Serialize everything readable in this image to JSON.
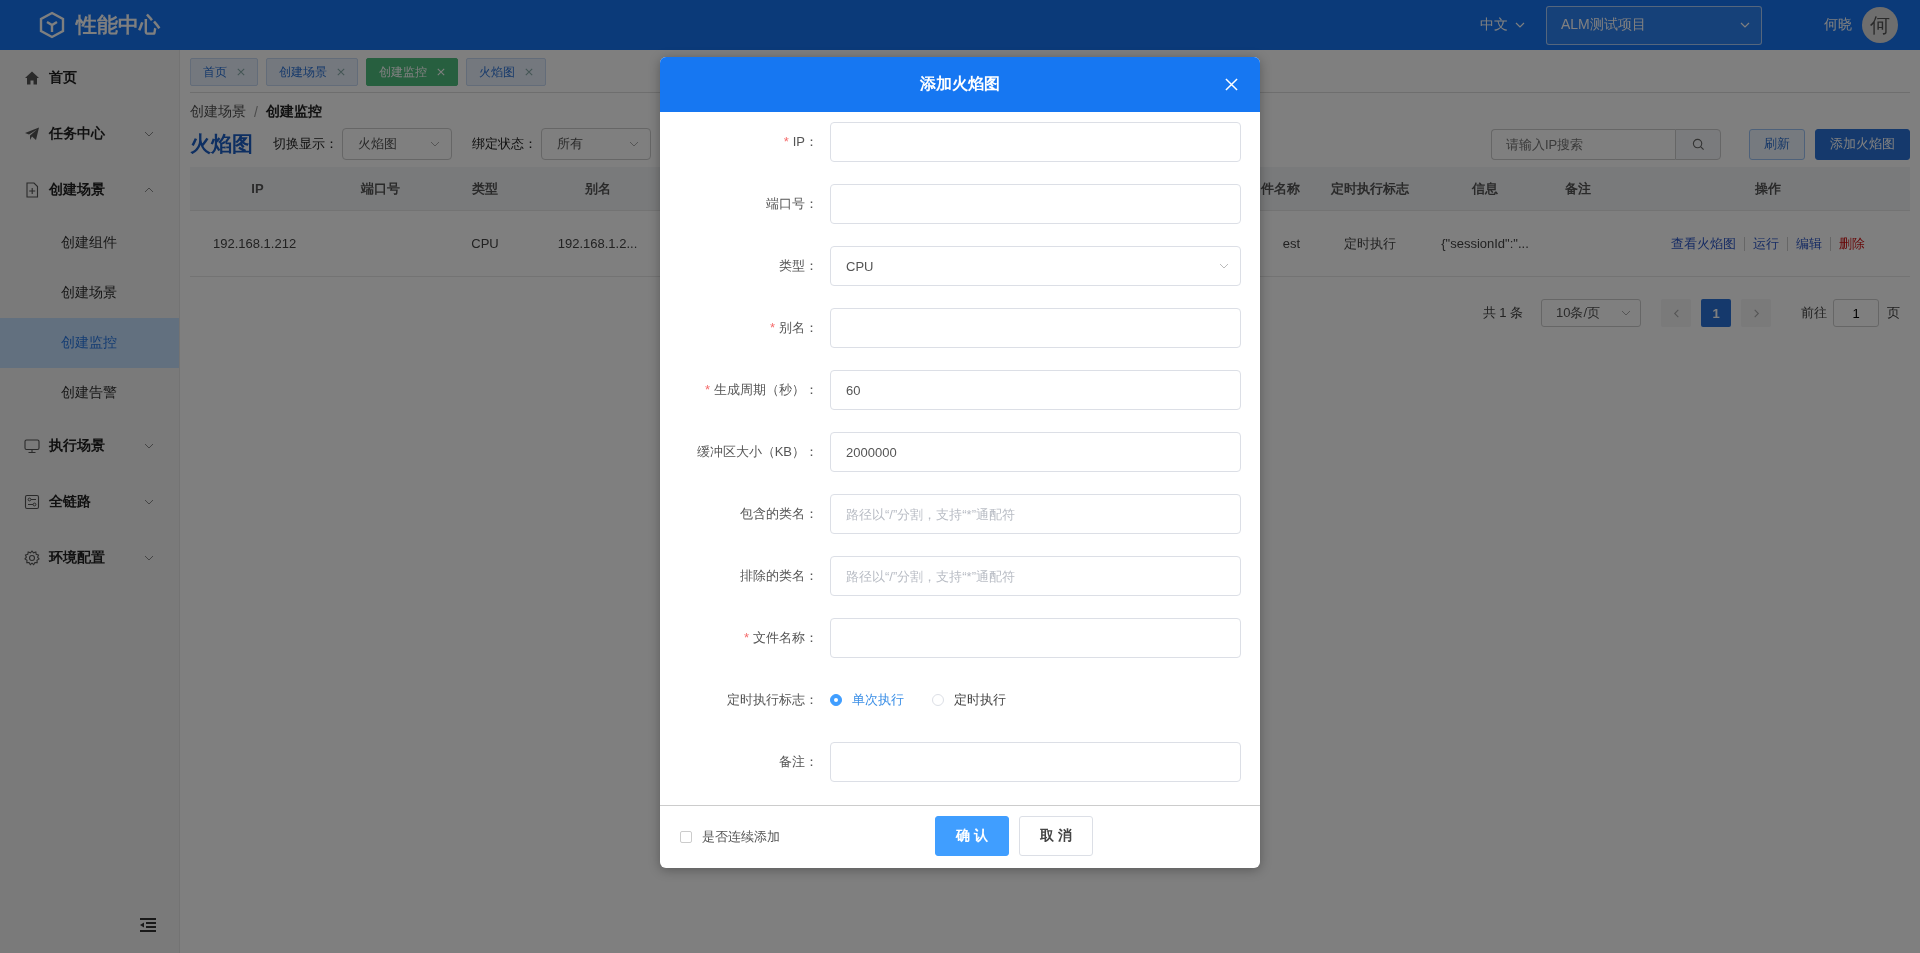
{
  "header": {
    "logo_text": "性能中心",
    "language": "中文",
    "project": "ALM测试项目",
    "user_name": "何晓",
    "avatar_text": "何"
  },
  "sidebar": {
    "items": [
      {
        "label": "首页",
        "selected": false
      },
      {
        "label": "任务中心",
        "selected": false,
        "expanded": false
      },
      {
        "label": "创建场景",
        "selected": false,
        "expanded": true,
        "children": [
          {
            "label": "创建组件",
            "selected": false
          },
          {
            "label": "创建场景",
            "selected": false
          },
          {
            "label": "创建监控",
            "selected": true
          },
          {
            "label": "创建告警",
            "selected": false
          }
        ]
      },
      {
        "label": "执行场景",
        "selected": false,
        "expanded": false
      },
      {
        "label": "全链路",
        "selected": false,
        "expanded": false
      },
      {
        "label": "环境配置",
        "selected": false,
        "expanded": false
      }
    ]
  },
  "tabs": [
    {
      "label": "首页",
      "selected": false
    },
    {
      "label": "创建场景",
      "selected": false
    },
    {
      "label": "创建监控",
      "selected": true
    },
    {
      "label": "火焰图",
      "selected": false
    }
  ],
  "breadcrumb_separator": "/",
  "breadcrumb": [
    {
      "label": "创建场景",
      "current": false
    },
    {
      "label": "创建监控",
      "current": true
    }
  ],
  "page_title": "火焰图",
  "filters": [
    {
      "label": "切换显示：",
      "value": "火焰图"
    },
    {
      "label": "绑定状态：",
      "value": "所有"
    }
  ],
  "search": {
    "placeholder": "请输入IP搜索"
  },
  "toolbar_buttons": [
    {
      "label": "刷新",
      "kind": "plain"
    },
    {
      "label": "添加火焰图",
      "kind": "primary"
    }
  ],
  "table": {
    "columns": [
      "IP",
      "端口号",
      "类型",
      "别名",
      "件名称",
      "定时执行标志",
      "信息",
      "备注",
      "操作"
    ],
    "rows": [
      {
        "cells": [
          "192.168.1.212",
          "",
          "CPU",
          "192.168.1.2...",
          "est",
          "定时执行",
          "{\"sessionId\":\"...",
          ""
        ],
        "actions": [
          {
            "label": "查看火焰图",
            "kind": "link"
          },
          {
            "label": "运行",
            "kind": "link"
          },
          {
            "label": "编辑",
            "kind": "link"
          },
          {
            "label": "删除",
            "kind": "danger"
          }
        ]
      }
    ]
  },
  "pagination": {
    "total": "共 1 条",
    "page_size": "10条/页",
    "pages": [
      {
        "label": "1",
        "selected": true
      }
    ],
    "goto_label": "前往",
    "goto_value": "1",
    "goto_suffix": "页"
  },
  "dialog": {
    "title": "添加火焰图",
    "required_mark": "*",
    "fields": [
      {
        "label": "IP：",
        "required": true,
        "kind": "input"
      },
      {
        "label": "端口号：",
        "required": false,
        "kind": "input"
      },
      {
        "label": "类型：",
        "required": false,
        "kind": "select",
        "value": "CPU"
      },
      {
        "label": "别名：",
        "required": true,
        "kind": "input"
      },
      {
        "label": "生成周期（秒）：",
        "required": true,
        "kind": "input",
        "value": "60"
      },
      {
        "label": "缓冲区大小（KB）：",
        "required": false,
        "kind": "input",
        "value": "2000000"
      },
      {
        "label": "包含的类名：",
        "required": false,
        "kind": "input",
        "placeholder": "路径以“/”分割，支持“*”通配符"
      },
      {
        "label": "排除的类名：",
        "required": false,
        "kind": "input",
        "placeholder": "路径以“/”分割，支持“*”通配符"
      },
      {
        "label": "文件名称：",
        "required": true,
        "kind": "input"
      },
      {
        "label": "定时执行标志：",
        "required": false,
        "kind": "radio",
        "options": [
          {
            "label": "单次执行",
            "selected": true
          },
          {
            "label": "定时执行",
            "selected": false
          }
        ]
      },
      {
        "label": "备注：",
        "required": false,
        "kind": "input"
      }
    ],
    "continuous": {
      "label": "是否连续添加",
      "checked": false
    },
    "buttons": [
      {
        "label": "确 认",
        "kind": "primary"
      },
      {
        "label": "取 消",
        "kind": "default"
      }
    ]
  }
}
